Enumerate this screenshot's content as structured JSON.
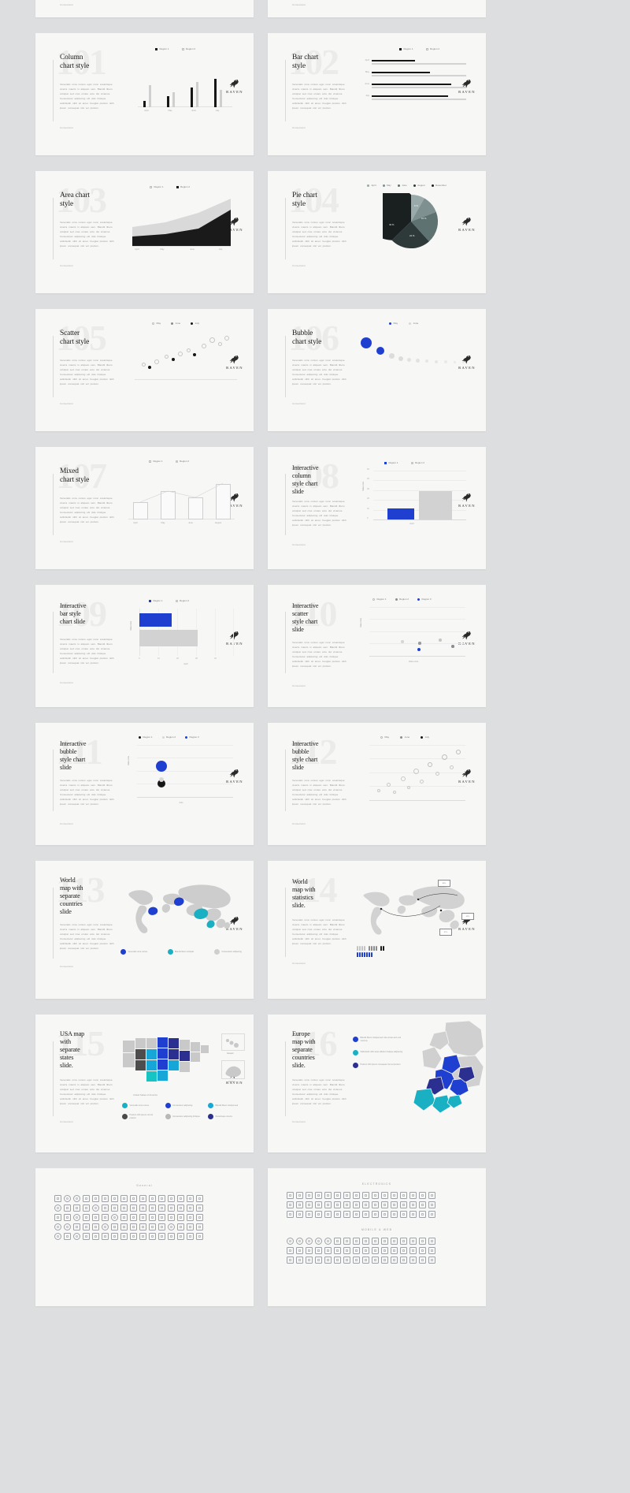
{
  "page": {
    "background": "#dcdee0",
    "brand": {
      "name": "RAVEN",
      "accent_blue": "#1f3fd0",
      "accent_teal": "#19b0c4",
      "dark": "#161616"
    },
    "body_lorem": "Venenatis urna cursus eget nunc scelerisque viverra mauris in aliquam sem. Blandit libero volutpat sed cras ornare arcu dui vivamus. Consectetur adipiscing elit duis tristique sollicitudin nibh sit amet. Feugiat pretium nibh ipsum consequat nisl vel pretium.",
    "foot_lorem": "Consectetur"
  },
  "slides": [
    {
      "num": "101",
      "title": "Column\nchart style",
      "kind": "column",
      "chart_data": {
        "type": "bar",
        "title": "Column chart style",
        "categories": [
          "April",
          "May",
          "June",
          "July"
        ],
        "series": [
          {
            "name": "Region 1",
            "color": "#161616",
            "values": [
              14,
              22,
              40,
              58
            ]
          },
          {
            "name": "Region 2",
            "color": "#cfcfcf",
            "values": [
              45,
              30,
              52,
              36
            ]
          }
        ],
        "ylim": [
          0,
          70
        ],
        "xlabel": "",
        "ylabel": "",
        "legend": "top"
      }
    },
    {
      "num": "102",
      "title": "Bar chart\nstyle",
      "kind": "bar",
      "chart_data": {
        "type": "bar",
        "title": "Bar chart style",
        "orientation": "horizontal",
        "categories": [
          "April",
          "May",
          "June",
          "July"
        ],
        "series": [
          {
            "name": "Region 1",
            "color": "#161616",
            "values": [
              46,
              62,
              84,
              81
            ]
          },
          {
            "name": "Region 2",
            "color": "#d3d3d3",
            "values": [
              100,
              100,
              100,
              100
            ]
          }
        ],
        "legend": "top"
      }
    },
    {
      "num": "103",
      "title": "Area chart\nstyle",
      "kind": "area",
      "chart_data": {
        "type": "area",
        "title": "Area chart style",
        "categories": [
          "April",
          "May",
          "June",
          "July"
        ],
        "series": [
          {
            "name": "Region 1",
            "color": "#cfcfcf",
            "values": [
              30,
              38,
              56,
              86
            ]
          },
          {
            "name": "Region 2",
            "color": "#161616",
            "values": [
              18,
              20,
              30,
              62
            ]
          }
        ],
        "legend": "top"
      }
    },
    {
      "num": "104",
      "title": "Pie chart\nstyle",
      "kind": "pie",
      "chart_data": {
        "type": "pie",
        "title": "Pie chart style",
        "labels": [
          "April",
          "May",
          "June",
          "August",
          "December"
        ],
        "values": [
          8,
          9,
          16,
          24,
          43
        ],
        "value_labels": [
          "8 %",
          "9 %",
          "16 %",
          "24 %",
          "43 %"
        ],
        "colors": [
          "#9aa9a9",
          "#7e9090",
          "#5e7272",
          "#2e3a3a",
          "#1a1f1f"
        ],
        "legend": "top"
      }
    },
    {
      "num": "105",
      "title": "Scatter\nchart style",
      "kind": "scatter",
      "chart_data": {
        "type": "scatter",
        "title": "Scatter chart style",
        "series": [
          {
            "name": "May",
            "color": "#c9c9c9"
          },
          {
            "name": "June",
            "color": "#8c8c8c"
          },
          {
            "name": "July",
            "color": "#161616"
          }
        ],
        "legend": "top"
      }
    },
    {
      "num": "106",
      "title": "Bubble\nchart style",
      "kind": "bubble",
      "chart_data": {
        "type": "scatter",
        "title": "Bubble chart style",
        "series": [
          {
            "name": "May",
            "color": "#1f3fd0"
          },
          {
            "name": "June",
            "color": "#d8d8d8"
          }
        ],
        "legend": "top"
      }
    },
    {
      "num": "107",
      "title": "Mixed\nchart style",
      "kind": "mixed",
      "chart_data": {
        "type": "bar",
        "title": "Mixed chart style",
        "categories": [
          "April",
          "May",
          "June",
          "August"
        ],
        "series": [
          {
            "name": "Region 1",
            "color": "#ffffff",
            "values": [
              34,
              56,
              44,
              70
            ]
          },
          {
            "name": "Region 2",
            "color": "#e9e9e9",
            "values": [
              20,
              30,
              26,
              40
            ]
          }
        ],
        "legend": "top"
      }
    },
    {
      "num": "108",
      "title": "Interactive\ncolumn\nstyle chart\nslide",
      "kind": "icolumn",
      "chart_data": {
        "type": "bar",
        "title": "Interactive column style chart slide",
        "categories": [
          "Region 1",
          "Region 2"
        ],
        "values": [
          22,
          58
        ],
        "colors": [
          "#1f3fd0",
          "#d2d2d2"
        ],
        "ylabel": "Value Axis",
        "xlabel": "April",
        "yticks": [
          "0",
          "10",
          "20",
          "30",
          "40",
          "50"
        ],
        "legend": "top"
      }
    },
    {
      "num": "109",
      "title": "Interactive\nbar style\nchart slide",
      "kind": "ibar",
      "chart_data": {
        "type": "bar",
        "orientation": "horizontal",
        "title": "Interactive bar style chart slide",
        "categories": [
          "Region 1",
          "Region 2"
        ],
        "values": [
          34,
          62
        ],
        "colors": [
          "#1f3fd0",
          "#d2d2d2"
        ],
        "ylabel": "Value Axis",
        "xlabel": "April",
        "xticks": [
          "0",
          "10",
          "20",
          "30",
          "40",
          "50"
        ],
        "legend": "top"
      }
    },
    {
      "num": "110",
      "title": "Interactive\nscatter\nstyle chart\nslide",
      "kind": "iscatter",
      "chart_data": {
        "type": "scatter",
        "title": "Interactive scatter style chart slide",
        "series": [
          {
            "name": "Region 1",
            "color": "#c9c9c9"
          },
          {
            "name": "Region 2",
            "color": "#8c8c8c"
          },
          {
            "name": "Region 3",
            "color": "#1f3fd0"
          }
        ],
        "ylabel": "Value Axis",
        "xlabel": "Value Axis",
        "legend": "top"
      }
    },
    {
      "num": "111",
      "title": "Interactive\nbubble\nstyle chart\nslide",
      "kind": "ibubble",
      "chart_data": {
        "type": "scatter",
        "title": "Interactive bubble style chart slide",
        "series": [
          {
            "name": "Region 1",
            "color": "#161616"
          },
          {
            "name": "Region 2",
            "color": "#d8d8d8"
          },
          {
            "name": "Region 3",
            "color": "#1f3fd0"
          }
        ],
        "ylabel": "Value Axis",
        "xlabel": "Axis",
        "legend": "top"
      }
    },
    {
      "num": "112",
      "title": "Interactive\nbubble\nstyle chart\nslide",
      "kind": "ibubble2",
      "chart_data": {
        "type": "scatter",
        "title": "Interactive bubble style chart slide",
        "series": [
          {
            "name": "May",
            "color": "#c9c9c9"
          },
          {
            "name": "June",
            "color": "#8c8c8c"
          },
          {
            "name": "July",
            "color": "#161616"
          }
        ],
        "legend": "top"
      }
    },
    {
      "num": "113",
      "title": "World\nmap with\nseparate\ncountries\nslide",
      "kind": "worldmap",
      "legend": [
        {
          "color": "#1f3fd0",
          "text": "Venenatis urna cursus"
        },
        {
          "color": "#19b0c4",
          "text": "Blandit libero volutpat"
        },
        {
          "color": "#cfcfcf",
          "text": "Consectetur adipiscing"
        }
      ]
    },
    {
      "num": "114",
      "title": "World\nmap with\nstatistics\nslide.",
      "kind": "worldstats",
      "callouts": [
        "85%",
        "62%",
        "47%"
      ]
    },
    {
      "num": "115",
      "title": "USA map\nwith\nseparate\nstates\nslide.",
      "kind": "usamap",
      "captions": [
        "United States of America",
        "Hawaii",
        "Alaska"
      ],
      "legend": [
        {
          "color": "#19b0c4",
          "text": "Venenatis urna cursus"
        },
        {
          "color": "#1f3fd0",
          "text": "Consectetur adipiscing"
        },
        {
          "color": "#16a8d8",
          "text": "Blandit libero volutpat sed"
        },
        {
          "color": "#4a4a4a",
          "text": "Pretium nibh ipsum nisl vel pretium"
        },
        {
          "color": "#b8b8b8",
          "text": "Consectetur adipiscing tristique"
        },
        {
          "color": "#2b2f8f",
          "text": "Scelerisque viverra"
        }
      ]
    },
    {
      "num": "116",
      "title": "Europe\nmap with\nseparate\ncountries\nslide.",
      "kind": "europemap",
      "legend": [
        {
          "color": "#1f3fd0",
          "text": "Blandit libero volutpat sed cras ornare arcu dui vivamus"
        },
        {
          "color": "#19b0c4",
          "text": "Sollicitudin nibh amet efficitur tristique adipiscing"
        },
        {
          "color": "#2b2f8f",
          "text": "Pretium nibh ipsum consequat nisl vel pretium"
        }
      ]
    },
    {
      "num": "117",
      "title": "",
      "kind": "icons",
      "header": "General"
    },
    {
      "num": "118",
      "title": "",
      "kind": "icons2",
      "header_a": "ELECTRONICS",
      "header_b": "MOBILE & WEB"
    }
  ]
}
